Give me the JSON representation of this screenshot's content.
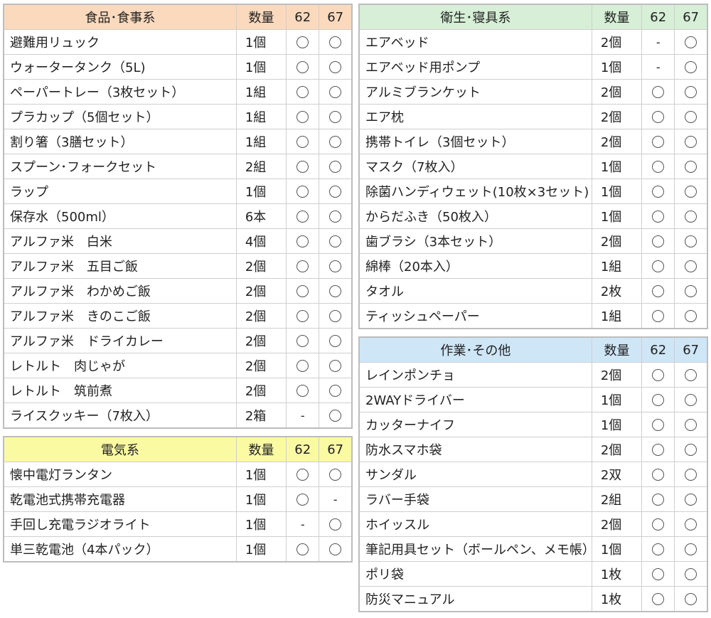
{
  "colors": {
    "food": "#fbd9bd",
    "electric": "#fafaa3",
    "hygiene": "#d6efd6",
    "work": "#cfe6f7"
  },
  "mark_icons": {
    "circle": "circle-mark-icon",
    "dash": "dash-mark-icon"
  },
  "tables": [
    {
      "id": "food",
      "header": {
        "category": "食品･食事系",
        "qty": "数量",
        "c62": "62",
        "c67": "67"
      },
      "rows": [
        {
          "name": "避難用リュック",
          "qty": "1個",
          "c62": "○",
          "c67": "○"
        },
        {
          "name": "ウォータータンク（5L)",
          "qty": "1個",
          "c62": "○",
          "c67": "○"
        },
        {
          "name": "ペーパートレー（3枚セット）",
          "qty": "1組",
          "c62": "○",
          "c67": "○"
        },
        {
          "name": "プラカップ（5個セット）",
          "qty": "1組",
          "c62": "○",
          "c67": "○"
        },
        {
          "name": "割り箸（3膳セット）",
          "qty": "1組",
          "c62": "○",
          "c67": "○"
        },
        {
          "name": "スプーン･フォークセット",
          "qty": "2組",
          "c62": "○",
          "c67": "○"
        },
        {
          "name": "ラップ",
          "qty": "1個",
          "c62": "○",
          "c67": "○"
        },
        {
          "name": "保存水（500ml）",
          "qty": "6本",
          "c62": "○",
          "c67": "○"
        },
        {
          "name": "アルファ米　白米",
          "qty": "4個",
          "c62": "○",
          "c67": "○"
        },
        {
          "name": "アルファ米　五目ご飯",
          "qty": "2個",
          "c62": "○",
          "c67": "○"
        },
        {
          "name": "アルファ米　わかめご飯",
          "qty": "2個",
          "c62": "○",
          "c67": "○"
        },
        {
          "name": "アルファ米　きのこご飯",
          "qty": "2個",
          "c62": "○",
          "c67": "○"
        },
        {
          "name": "アルファ米　ドライカレー",
          "qty": "2個",
          "c62": "○",
          "c67": "○"
        },
        {
          "name": "レトルト　肉じゃが",
          "qty": "2個",
          "c62": "○",
          "c67": "○"
        },
        {
          "name": "レトルト　筑前煮",
          "qty": "2個",
          "c62": "○",
          "c67": "○"
        },
        {
          "name": "ライスクッキー（7枚入）",
          "qty": "2箱",
          "c62": "-",
          "c67": "○"
        }
      ]
    },
    {
      "id": "electric",
      "header": {
        "category": "電気系",
        "qty": "数量",
        "c62": "62",
        "c67": "67"
      },
      "rows": [
        {
          "name": "懐中電灯ランタン",
          "qty": "1個",
          "c62": "○",
          "c67": "○"
        },
        {
          "name": "乾電池式携帯充電器",
          "qty": "1個",
          "c62": "○",
          "c67": "-"
        },
        {
          "name": "手回し充電ラジオライト",
          "qty": "1個",
          "c62": "-",
          "c67": "○"
        },
        {
          "name": "単三乾電池（4本パック）",
          "qty": "1個",
          "c62": "○",
          "c67": "○"
        }
      ]
    },
    {
      "id": "hygiene",
      "header": {
        "category": "衛生･寝具系",
        "qty": "数量",
        "c62": "62",
        "c67": "67"
      },
      "rows": [
        {
          "name": "エアベッド",
          "qty": "2個",
          "c62": "-",
          "c67": "○"
        },
        {
          "name": "エアベッド用ポンプ",
          "qty": "1個",
          "c62": "-",
          "c67": "○"
        },
        {
          "name": "アルミブランケット",
          "qty": "2個",
          "c62": "○",
          "c67": "○"
        },
        {
          "name": "エア枕",
          "qty": "2個",
          "c62": "○",
          "c67": "○"
        },
        {
          "name": "携帯トイレ（3個セット）",
          "qty": "2個",
          "c62": "○",
          "c67": "○"
        },
        {
          "name": "マスク（7枚入）",
          "qty": "1個",
          "c62": "○",
          "c67": "○"
        },
        {
          "name": "除菌ハンディウェット(10枚×3セット)",
          "qty": "1個",
          "c62": "○",
          "c67": "○"
        },
        {
          "name": "からだふき（50枚入）",
          "qty": "1個",
          "c62": "○",
          "c67": "○"
        },
        {
          "name": "歯ブラシ（3本セット）",
          "qty": "2個",
          "c62": "○",
          "c67": "○"
        },
        {
          "name": "綿棒（20本入）",
          "qty": "1組",
          "c62": "○",
          "c67": "○"
        },
        {
          "name": "タオル",
          "qty": "2枚",
          "c62": "○",
          "c67": "○"
        },
        {
          "name": "ティッシュペーパー",
          "qty": "1組",
          "c62": "○",
          "c67": "○"
        }
      ]
    },
    {
      "id": "work",
      "header": {
        "category": "作業･その他",
        "qty": "数量",
        "c62": "62",
        "c67": "67"
      },
      "rows": [
        {
          "name": "レインポンチョ",
          "qty": "2個",
          "c62": "○",
          "c67": "○"
        },
        {
          "name": "2WAYドライバー",
          "qty": "1個",
          "c62": "○",
          "c67": "○"
        },
        {
          "name": "カッターナイフ",
          "qty": "1個",
          "c62": "○",
          "c67": "○"
        },
        {
          "name": "防水スマホ袋",
          "qty": "2個",
          "c62": "○",
          "c67": "○"
        },
        {
          "name": "サンダル",
          "qty": "2双",
          "c62": "○",
          "c67": "○"
        },
        {
          "name": "ラバー手袋",
          "qty": "2組",
          "c62": "○",
          "c67": "○"
        },
        {
          "name": "ホイッスル",
          "qty": "2個",
          "c62": "○",
          "c67": "○"
        },
        {
          "name": "筆記用具セット（ボールペン、メモ帳）",
          "qty": "1個",
          "c62": "○",
          "c67": "○"
        },
        {
          "name": "ポリ袋",
          "qty": "1枚",
          "c62": "○",
          "c67": "○"
        },
        {
          "name": "防災マニュアル",
          "qty": "1枚",
          "c62": "○",
          "c67": "○"
        }
      ]
    }
  ]
}
